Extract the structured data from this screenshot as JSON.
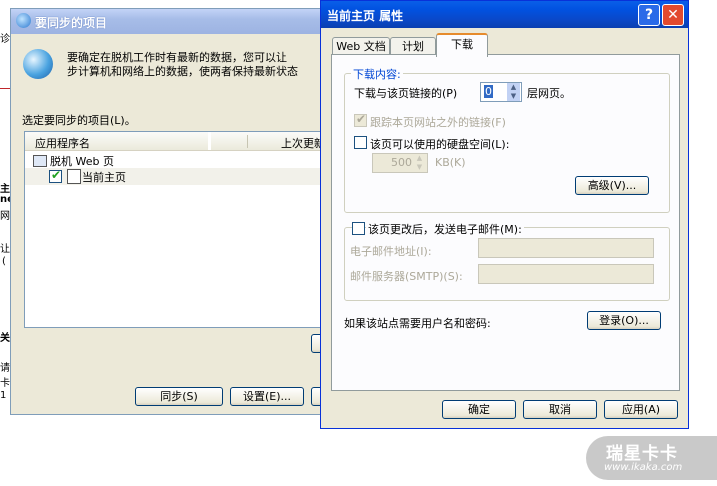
{
  "background": {
    "edge_texts": [
      "诊",
      "主",
      "ne",
      "网",
      "让",
      "(",
      "关",
      "请",
      "卡",
      "1",
      "0"
    ]
  },
  "sync_window": {
    "title": "要同步的项目",
    "intro_line1": "要确定在脱机工作时有最新的数据，您可以让",
    "intro_line2": "步计算机和网络上的数据，使两者保持最新状态",
    "select_label": "选定要同步的项目(L)。",
    "columns": [
      "应用程序名",
      "上次更新"
    ],
    "tree_root": "脱机 Web 页",
    "tree_child": "当前主页",
    "buttons": {
      "sync": "同步(S)",
      "settings": "设置(E)..."
    }
  },
  "props_window": {
    "title": "当前主页 属性",
    "title_buttons": {
      "help": "?",
      "close": "✕"
    },
    "tabs": [
      "Web 文档",
      "计划",
      "下载"
    ],
    "active_tab": "下载",
    "download_group": {
      "label": "下载内容:",
      "depth_label": "下载与该页链接的(P)",
      "depth_value": "0",
      "depth_suffix": "层网页。",
      "follow_links_label": "跟踪本页网站之外的链接(F)",
      "limit_space_label": "该页可以使用的硬盘空间(L):",
      "space_value": "500",
      "space_unit": "KB(K)",
      "advanced_button": "高级(V)..."
    },
    "email_group": {
      "notify_label": "该页更改后，发送电子邮件(M):",
      "email_address_label": "电子邮件地址(I):",
      "mail_server_label": "邮件服务器(SMTP)(S):"
    },
    "login_prompt": "如果该站点需要用户名和密码:",
    "login_button": "登录(O)...",
    "footer_buttons": {
      "ok": "确定",
      "cancel": "取消",
      "apply": "应用(A)"
    }
  },
  "watermark": {
    "brand": "瑞星卡卡",
    "url": "www.ikaka.com"
  },
  "colors": {
    "title_blue": "#0a52dd",
    "dialog_bg": "#ece9d8",
    "accent_red": "#c0262b"
  }
}
